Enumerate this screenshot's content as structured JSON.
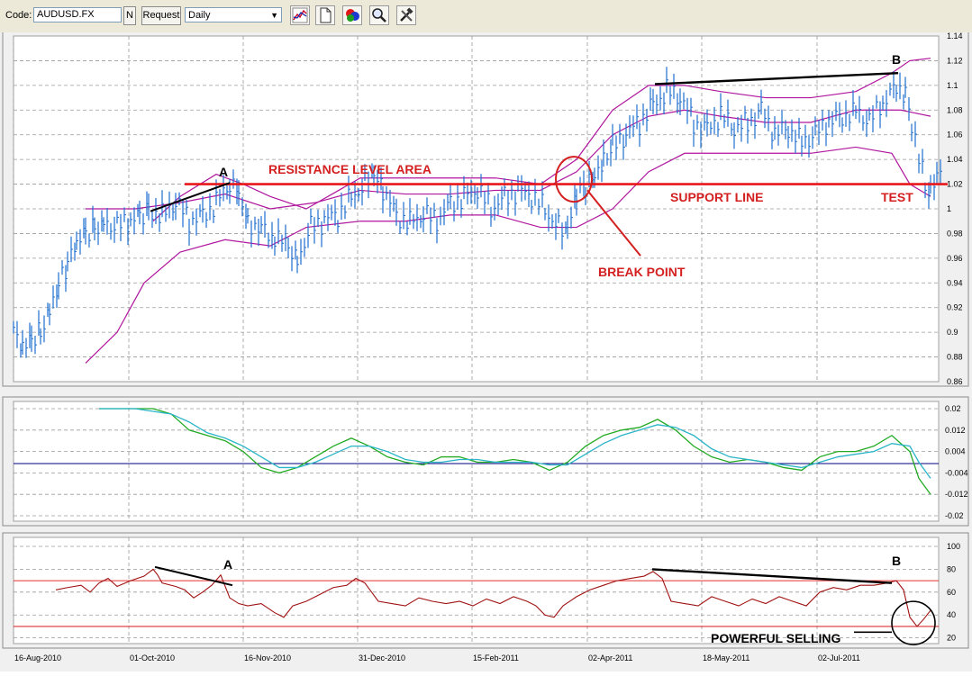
{
  "toolbar": {
    "code_label": "Code:",
    "code_value": "AUDUSD.FX",
    "n_button": "N",
    "request_button": "Request",
    "period_value": "Daily"
  },
  "chart_data": [
    {
      "type": "line",
      "panel": "price",
      "title": "",
      "x": [
        "16-Aug-2010",
        "01-Oct-2010",
        "16-Nov-2010",
        "31-Dec-2010",
        "15-Feb-2011",
        "02-Apr-2011",
        "18-May-2011",
        "02-Jul-2011"
      ],
      "ylim": [
        0.86,
        1.14
      ],
      "yticks": [
        0.86,
        0.88,
        0.9,
        0.92,
        0.94,
        0.96,
        0.98,
        1,
        1.02,
        1.04,
        1.06,
        1.08,
        1.1,
        1.12,
        1.14
      ],
      "grid": true,
      "series": [
        {
          "name": "",
          "color": "#1f6fd0",
          "style": "ohlc-bars",
          "points": [
            [
              0,
              0.9
            ],
            [
              10,
              0.885
            ],
            [
              20,
              0.892
            ],
            [
              30,
              0.9
            ],
            [
              40,
              0.92
            ],
            [
              50,
              0.94
            ],
            [
              60,
              0.955
            ],
            [
              70,
              0.97
            ],
            [
              80,
              0.98
            ],
            [
              90,
              0.985
            ],
            [
              100,
              0.99
            ],
            [
              115,
              0.985
            ],
            [
              130,
              0.99
            ],
            [
              140,
              0.995
            ],
            [
              150,
              1.0
            ],
            [
              165,
              0.995
            ],
            [
              180,
              1.005
            ],
            [
              195,
              0.99
            ],
            [
              210,
              0.995
            ],
            [
              225,
              1.005
            ],
            [
              240,
              1.02
            ],
            [
              250,
              1.015
            ],
            [
              260,
              0.99
            ],
            [
              275,
              0.985
            ],
            [
              290,
              0.975
            ],
            [
              305,
              0.97
            ],
            [
              315,
              0.96
            ],
            [
              330,
              0.985
            ],
            [
              345,
              0.99
            ],
            [
              360,
              0.995
            ],
            [
              375,
              1.01
            ],
            [
              390,
              1.02
            ],
            [
              400,
              1.025
            ],
            [
              410,
              1.015
            ],
            [
              425,
              0.995
            ],
            [
              440,
              0.99
            ],
            [
              455,
              0.995
            ],
            [
              470,
              0.99
            ],
            [
              485,
              1.005
            ],
            [
              500,
              1.01
            ],
            [
              515,
              1.015
            ],
            [
              530,
              1.0
            ],
            [
              545,
              1.01
            ],
            [
              560,
              1.015
            ],
            [
              575,
              1.01
            ],
            [
              590,
              1.0
            ],
            [
              605,
              0.985
            ],
            [
              615,
              0.98
            ],
            [
              625,
              1.01
            ],
            [
              635,
              1.02
            ],
            [
              645,
              1.03
            ],
            [
              655,
              1.04
            ],
            [
              665,
              1.05
            ],
            [
              680,
              1.06
            ],
            [
              695,
              1.07
            ],
            [
              710,
              1.085
            ],
            [
              725,
              1.095
            ],
            [
              740,
              1.09
            ],
            [
              755,
              1.07
            ],
            [
              770,
              1.065
            ],
            [
              785,
              1.075
            ],
            [
              800,
              1.065
            ],
            [
              815,
              1.07
            ],
            [
              830,
              1.08
            ],
            [
              845,
              1.06
            ],
            [
              860,
              1.065
            ],
            [
              875,
              1.055
            ],
            [
              890,
              1.06
            ],
            [
              905,
              1.07
            ],
            [
              920,
              1.075
            ],
            [
              935,
              1.08
            ],
            [
              950,
              1.07
            ],
            [
              965,
              1.085
            ],
            [
              980,
              1.1
            ],
            [
              990,
              1.095
            ],
            [
              997,
              1.07
            ],
            [
              1005,
              1.04
            ],
            [
              1012,
              1.02
            ],
            [
              1018,
              1.01
            ],
            [
              1025,
              1.03
            ],
            [
              1033,
              1.04
            ]
          ]
        },
        {
          "name": "",
          "color": "#b0169e",
          "style": "line",
          "points": [
            [
              95,
              1.0
            ],
            [
              150,
              1.0
            ],
            [
              200,
              1.005
            ],
            [
              250,
              1.012
            ],
            [
              300,
              1.0
            ],
            [
              350,
              1.005
            ],
            [
              400,
              1.015
            ],
            [
              450,
              1.012
            ],
            [
              500,
              1.012
            ],
            [
              550,
              1.015
            ],
            [
              600,
              1.015
            ],
            [
              640,
              1.03
            ],
            [
              680,
              1.06
            ],
            [
              720,
              1.075
            ],
            [
              760,
              1.08
            ],
            [
              800,
              1.075
            ],
            [
              850,
              1.07
            ],
            [
              900,
              1.07
            ],
            [
              950,
              1.08
            ],
            [
              1000,
              1.08
            ],
            [
              1033,
              1.075
            ]
          ]
        },
        {
          "name": "",
          "color": "#b0169e",
          "style": "line",
          "points": [
            [
              170,
              0.99
            ],
            [
              200,
              1.01
            ],
            [
              240,
              1.028
            ],
            [
              270,
              1.02
            ],
            [
              300,
              1.01
            ],
            [
              340,
              1.0
            ],
            [
              400,
              1.025
            ],
            [
              450,
              1.025
            ],
            [
              500,
              1.025
            ],
            [
              550,
              1.025
            ],
            [
              600,
              1.02
            ],
            [
              640,
              1.04
            ],
            [
              680,
              1.08
            ],
            [
              720,
              1.1
            ],
            [
              760,
              1.1
            ],
            [
              800,
              1.095
            ],
            [
              850,
              1.09
            ],
            [
              900,
              1.09
            ],
            [
              950,
              1.095
            ],
            [
              990,
              1.11
            ],
            [
              1010,
              1.12
            ],
            [
              1033,
              1.122
            ]
          ]
        },
        {
          "name": "",
          "color": "#b0169e",
          "style": "line",
          "points": [
            [
              95,
              0.875
            ],
            [
              130,
              0.9
            ],
            [
              160,
              0.94
            ],
            [
              200,
              0.965
            ],
            [
              250,
              0.975
            ],
            [
              300,
              0.97
            ],
            [
              340,
              0.985
            ],
            [
              400,
              0.99
            ],
            [
              450,
              0.99
            ],
            [
              500,
              0.995
            ],
            [
              550,
              0.995
            ],
            [
              600,
              0.985
            ],
            [
              640,
              0.985
            ],
            [
              680,
              1.0
            ],
            [
              720,
              1.03
            ],
            [
              760,
              1.045
            ],
            [
              800,
              1.045
            ],
            [
              850,
              1.045
            ],
            [
              900,
              1.045
            ],
            [
              950,
              1.05
            ],
            [
              990,
              1.045
            ],
            [
              1010,
              1.02
            ],
            [
              1033,
              1.01
            ]
          ]
        }
      ],
      "annotations": [
        "A",
        "RESISTANCE LEVEL AREA",
        "BREAK POINT",
        "SUPPORT LINE",
        "TEST",
        "B"
      ]
    },
    {
      "type": "line",
      "panel": "oscillator",
      "title": "",
      "ylim": [
        -0.02,
        0.02
      ],
      "yticks": [
        -0.02,
        -0.012,
        -0.004,
        0.004,
        0.012,
        0.02
      ],
      "grid": true,
      "series": [
        {
          "name": "",
          "color": "#22aa22",
          "values_x": [
            110,
            130,
            150,
            170,
            190,
            210,
            230,
            250,
            270,
            290,
            310,
            330,
            350,
            370,
            390,
            410,
            430,
            450,
            470,
            490,
            510,
            530,
            550,
            570,
            590,
            610,
            630,
            650,
            670,
            690,
            710,
            730,
            750,
            770,
            790,
            810,
            830,
            850,
            870,
            890,
            910,
            930,
            950,
            970,
            990,
            1010,
            1020,
            1033
          ],
          "values": [
            0.02,
            0.02,
            0.02,
            0.02,
            0.018,
            0.012,
            0.01,
            0.008,
            0.004,
            -0.002,
            -0.004,
            -0.002,
            0.002,
            0.006,
            0.009,
            0.006,
            0.002,
            0.0,
            -0.001,
            0.002,
            0.002,
            0.0,
            0.0,
            0.001,
            0.0,
            -0.003,
            0.0,
            0.006,
            0.01,
            0.012,
            0.013,
            0.016,
            0.012,
            0.006,
            0.002,
            0.0,
            0.001,
            0.0,
            -0.002,
            -0.003,
            0.002,
            0.004,
            0.004,
            0.006,
            0.01,
            0.004,
            -0.006,
            -0.012
          ]
        },
        {
          "name": "",
          "color": "#2ab4c8",
          "values_x": [
            110,
            130,
            150,
            170,
            190,
            210,
            230,
            250,
            270,
            290,
            310,
            330,
            350,
            370,
            390,
            410,
            430,
            450,
            470,
            490,
            510,
            530,
            550,
            570,
            590,
            610,
            630,
            650,
            670,
            690,
            710,
            730,
            750,
            770,
            790,
            810,
            830,
            850,
            870,
            890,
            910,
            930,
            950,
            970,
            990,
            1010,
            1020,
            1033
          ],
          "values": [
            0.02,
            0.02,
            0.02,
            0.019,
            0.018,
            0.015,
            0.011,
            0.009,
            0.006,
            0.002,
            -0.002,
            -0.002,
            0.0,
            0.003,
            0.006,
            0.006,
            0.004,
            0.001,
            0.0,
            0.0,
            0.001,
            0.001,
            0.0,
            0.0,
            0.0,
            -0.001,
            -0.001,
            0.003,
            0.007,
            0.01,
            0.012,
            0.014,
            0.013,
            0.01,
            0.005,
            0.002,
            0.001,
            0.0,
            -0.001,
            -0.002,
            0.0,
            0.002,
            0.003,
            0.004,
            0.007,
            0.006,
            0.0,
            -0.006
          ]
        },
        {
          "name": "",
          "color": "#000080",
          "level": -0.0005
        }
      ]
    },
    {
      "type": "line",
      "panel": "rsi",
      "title": "",
      "ylim": [
        15,
        100
      ],
      "yticks": [
        20,
        40,
        60,
        80,
        100
      ],
      "grid": true,
      "levels": [
        70,
        30
      ],
      "series": [
        {
          "name": "",
          "color": "#a01010",
          "values_x": [
            62,
            75,
            90,
            100,
            110,
            120,
            130,
            145,
            160,
            170,
            175,
            180,
            195,
            205,
            215,
            225,
            235,
            245,
            255,
            265,
            275,
            290,
            305,
            315,
            325,
            340,
            355,
            370,
            385,
            395,
            405,
            420,
            435,
            450,
            465,
            480,
            495,
            510,
            525,
            540,
            555,
            570,
            585,
            595,
            605,
            615,
            625,
            640,
            655,
            670,
            685,
            700,
            715,
            725,
            735,
            745,
            760,
            775,
            790,
            805,
            820,
            835,
            850,
            865,
            880,
            895,
            910,
            925,
            940,
            955,
            970,
            985,
            995,
            1003,
            1010,
            1018,
            1025,
            1033
          ],
          "values": [
            62,
            64,
            66,
            60,
            68,
            72,
            65,
            70,
            74,
            80,
            75,
            68,
            65,
            62,
            55,
            60,
            66,
            75,
            55,
            50,
            48,
            50,
            42,
            38,
            48,
            52,
            58,
            64,
            66,
            72,
            68,
            52,
            50,
            48,
            55,
            52,
            50,
            52,
            48,
            54,
            50,
            56,
            52,
            48,
            40,
            38,
            48,
            56,
            62,
            66,
            70,
            72,
            74,
            78,
            72,
            52,
            50,
            48,
            56,
            52,
            48,
            54,
            50,
            56,
            52,
            48,
            60,
            64,
            62,
            66,
            66,
            68,
            70,
            62,
            38,
            30,
            36,
            44
          ]
        }
      ],
      "annotations": [
        "A",
        "B",
        "POWERFUL SELLING"
      ]
    }
  ],
  "panels": {
    "price_labels": {
      "a": "A",
      "b": "B",
      "resistance": "RESISTANCE LEVEL AREA",
      "break_point": "BREAK POINT",
      "support": "SUPPORT LINE",
      "test": "TEST"
    },
    "rsi_labels": {
      "a": "A",
      "b": "B",
      "powerful_selling": "POWERFUL SELLING"
    },
    "x_ticks": [
      "16-Aug-2010",
      "01-Oct-2010",
      "16-Nov-2010",
      "31-Dec-2010",
      "15-Feb-2011",
      "02-Apr-2011",
      "18-May-2011",
      "02-Jul-2011"
    ],
    "price_ticks": [
      "0.86",
      "0.88",
      "0.9",
      "0.92",
      "0.94",
      "0.96",
      "0.98",
      "1",
      "1.02",
      "1.04",
      "1.06",
      "1.08",
      "1.1",
      "1.12",
      "1.14"
    ],
    "osc_ticks": [
      "-0.02",
      "-0.012",
      "-0.004",
      "0.004",
      "0.012",
      "0.02"
    ],
    "rsi_ticks": [
      "20",
      "40",
      "60",
      "80",
      "100"
    ]
  },
  "colors": {
    "price_bars": "#1f6fd0",
    "bands": "#b0169e",
    "resistance": "#e8171b",
    "annotation_red": "#d42020",
    "rsi_line": "#a01010",
    "rsi_levels": "#e03030",
    "osc_green": "#22aa22",
    "osc_cyan": "#2ab4c8",
    "osc_zero": "#000080"
  }
}
